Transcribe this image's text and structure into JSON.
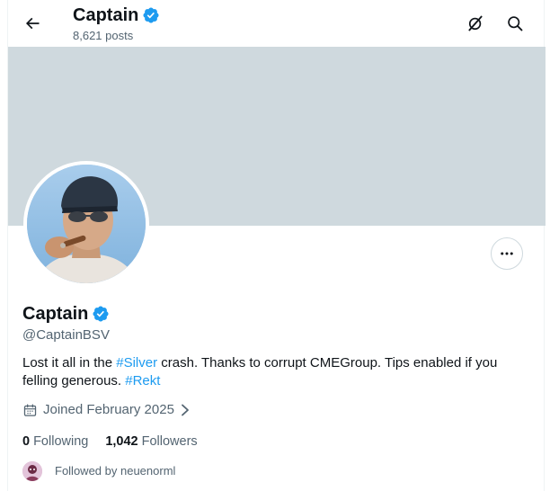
{
  "header": {
    "title": "Captain",
    "post_count": "8,621 posts",
    "back_icon": "arrow-left-icon",
    "grok_icon": "grok-icon",
    "search_icon": "search-icon"
  },
  "profile": {
    "name": "Captain",
    "handle": "@CaptainBSV",
    "verified": true,
    "bio": {
      "part1": "Lost it all in the ",
      "hashtag1": "#Silver",
      "part2": " crash. Thanks to corrupt CMEGroup. Tips enabled if you felling generous. ",
      "hashtag2": "#Rekt"
    },
    "joined": "Joined February 2025",
    "following_count": "0",
    "following_label": "Following",
    "followers_count": "1,042",
    "followers_label": "Followers",
    "followed_by": "Followed by neuenorml"
  },
  "colors": {
    "accent": "#1d9bf0",
    "banner": "#cfd9de",
    "muted_text": "#536471",
    "text": "#0f1419"
  }
}
